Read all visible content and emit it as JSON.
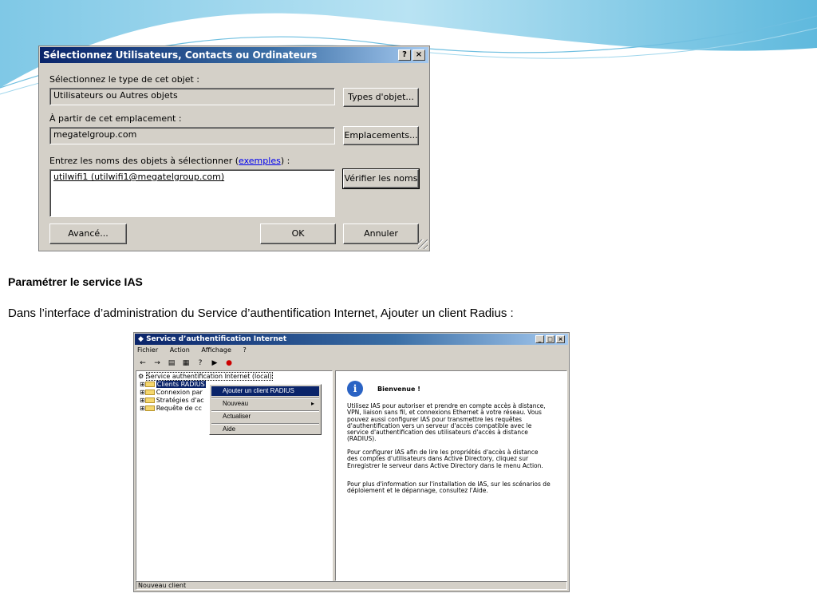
{
  "dialog": {
    "title": "Sélectionnez Utilisateurs, Contacts ou Ordinateurs",
    "help_btn": "?",
    "close_btn": "×",
    "type_label": "Sélectionnez le type de cet objet :",
    "type_value": "Utilisateurs ou Autres objets",
    "types_button": "Types d'objet...",
    "location_label": "À partir de cet emplacement :",
    "location_value": "megatelgroup.com",
    "locations_button": "Emplacements...",
    "names_label_prefix": "Entrez les noms des objets à sélectionner (",
    "names_label_link": "exemples",
    "names_label_suffix": ") :",
    "names_value": "utilwifi1 (utilwifi1@megatelgroup.com)",
    "check_names_button": "Vérifier les noms",
    "advanced_button": "Avancé...",
    "ok_button": "OK",
    "cancel_button": "Annuler"
  },
  "slide": {
    "heading": "Paramétrer le service IAS",
    "paragraph": "Dans l’interface d’administration du Service d’authentification Internet, Ajouter un client Radius :"
  },
  "ias": {
    "title": "Service d’authentification Internet",
    "menu": [
      "Fichier",
      "Action",
      "Affichage",
      "?"
    ],
    "tree_root": "Service authentification Internet (local)",
    "tree_items": [
      "Clients RADIUS",
      "Connexion par",
      "Stratégies d'ac",
      "Requête de cc"
    ],
    "context_menu": [
      "Ajouter un client RADIUS",
      "Nouveau",
      "Actualiser",
      "Aide"
    ],
    "welcome_title": "Bienvenue !",
    "welcome_p1": "Utilisez IAS pour autoriser et prendre en compte accès à distance, VPN, liaison sans fil, et connexions Ethernet à votre réseau. Vous pouvez aussi configurer IAS pour transmettre les requêtes d'authentification vers un serveur d'accès compatible avec le service d'authentification des utilisateurs d'accès à distance (RADIUS).",
    "welcome_p2": "Pour configurer IAS afin de lire les propriétés d'accès à distance des comptes d'utilisateurs dans Active Directory, cliquez sur Enregistrer le serveur dans Active Directory dans le menu Action.",
    "welcome_p3": "Pour plus d'information sur l'installation de IAS, sur les scénarios de déploiement et le dépannage, consultez l'Aide.",
    "status": "Nouveau client"
  }
}
